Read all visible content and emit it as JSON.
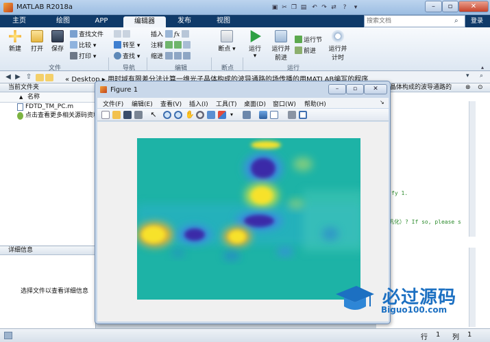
{
  "window": {
    "title": "MATLAB R2018a",
    "search_placeholder": "搜索文档",
    "login_label": "登录"
  },
  "tabs": [
    {
      "label": "主页"
    },
    {
      "label": "绘图"
    },
    {
      "label": "APP"
    },
    {
      "label": "编辑器",
      "active": true
    },
    {
      "label": "发布"
    },
    {
      "label": "视图"
    }
  ],
  "ribbon": {
    "file": {
      "group_label": "文件",
      "new_label": "新建",
      "open_label": "打开",
      "save_label": "保存",
      "find_files_label": "查找文件",
      "compare_label": "比较",
      "print_label": "打印"
    },
    "nav": {
      "group_label": "导航",
      "goto_label": "转至",
      "find_label": "查找"
    },
    "edit": {
      "group_label": "编辑",
      "insert_label": "插入",
      "fx_label": "fx",
      "comment_label": "注释",
      "indent_label": "缩进"
    },
    "breakpoints": {
      "group_label": "断点",
      "breakpoint_label": "断点"
    },
    "run": {
      "group_label": "运行",
      "run_label": "运行",
      "run_advance_label_1": "运行并",
      "run_advance_label_2": "前进",
      "run_section_label": "运行节",
      "advance_label": "前进",
      "run_time_label_1": "运行并",
      "run_time_label_2": "计时"
    }
  },
  "address_bar": {
    "prefix": "«",
    "path_root": "Desktop",
    "path_folder": "用时域有限差分法计算一维光子晶体构成的波导通路的场传播的用MATLAB编写的程序"
  },
  "current_folder": {
    "title": "当前文件夹",
    "column_name": "名称",
    "sort_indicator": "▲",
    "files": [
      {
        "name": "FDTD_TM_PC.m"
      },
      {
        "name": "点击查看更多相关源码资料"
      }
    ]
  },
  "details": {
    "title": "详细信息",
    "message": "选择文件以查看详细信息"
  },
  "editor": {
    "header_text": "晶体构成的波导通路的",
    "code_lines": [
      {
        "text": "fy 1."
      },
      {
        "text": "巩化）? If so, please s"
      }
    ]
  },
  "status": {
    "row_label": "行",
    "row_value": "1",
    "col_label": "列",
    "col_value": "1"
  },
  "figure": {
    "title": "Figure 1",
    "menu": [
      {
        "label": "文件(F)"
      },
      {
        "label": "编辑(E)"
      },
      {
        "label": "查看(V)"
      },
      {
        "label": "插入(I)"
      },
      {
        "label": "工具(T)"
      },
      {
        "label": "桌面(D)"
      },
      {
        "label": "窗口(W)"
      },
      {
        "label": "帮助(H)"
      }
    ]
  },
  "watermark": {
    "text": "必过源码",
    "url": "Biguo100.com"
  },
  "colors": {
    "tab_bar": "#0f3a69",
    "field_background": "#19b5a8",
    "peak_yellow": "#f7e22a",
    "trough_blue": "#3a2aa8",
    "watermark_blue": "#1c70c2"
  }
}
